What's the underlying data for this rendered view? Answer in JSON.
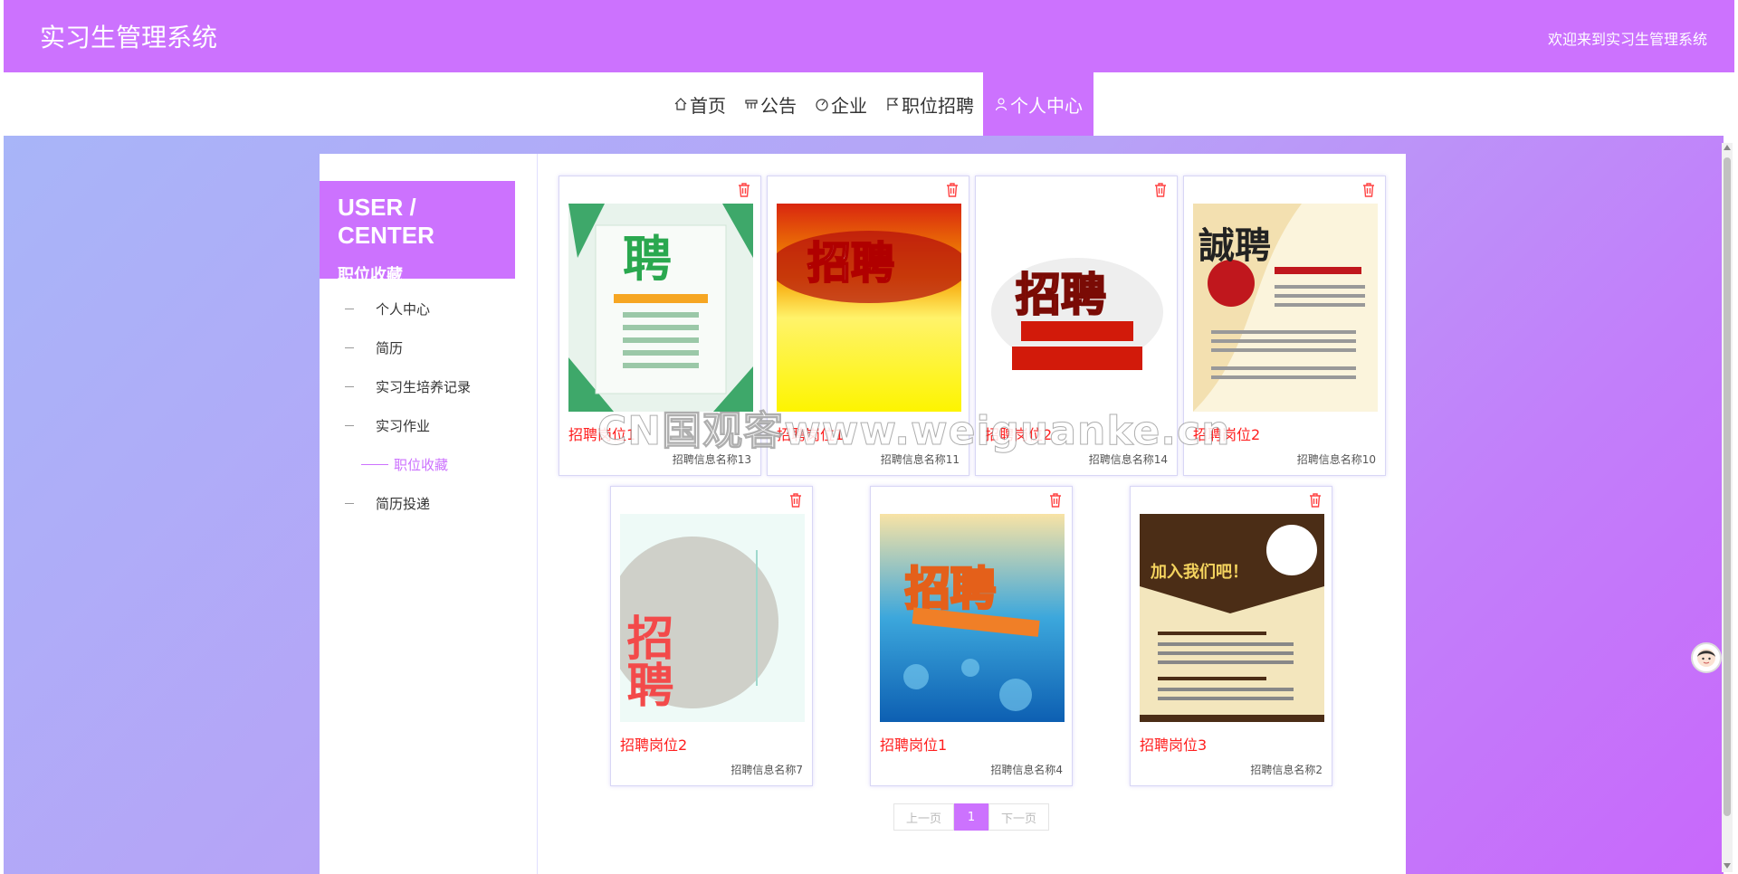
{
  "header": {
    "title": "实习生管理系统",
    "welcome": "欢迎来到实习生管理系统"
  },
  "nav": {
    "items": [
      {
        "label": "首页",
        "icon": "home-icon"
      },
      {
        "label": "公告",
        "icon": "notice-icon"
      },
      {
        "label": "企业",
        "icon": "dashboard-icon"
      },
      {
        "label": "职位招聘",
        "icon": "flag-icon"
      },
      {
        "label": "个人中心",
        "icon": "user-icon",
        "active": true
      }
    ]
  },
  "sidebar": {
    "head_en": "USER / CENTER",
    "head_cn": "职位收藏",
    "items": [
      {
        "label": "个人中心"
      },
      {
        "label": "简历"
      },
      {
        "label": "实习生培养记录"
      },
      {
        "label": "实习作业"
      },
      {
        "label": "职位收藏",
        "active": true
      },
      {
        "label": "简历投递"
      }
    ]
  },
  "cards": [
    {
      "title": "招聘岗位1",
      "subtitle": "招聘信息名称13",
      "poster_text": "聘"
    },
    {
      "title": "招聘岗位1",
      "subtitle": "招聘信息名称11",
      "poster_text": "招聘"
    },
    {
      "title": "招聘岗位2",
      "subtitle": "招聘信息名称14",
      "poster_text": "招聘"
    },
    {
      "title": "招聘岗位2",
      "subtitle": "招聘信息名称10",
      "poster_text": "誠聘"
    },
    {
      "title": "招聘岗位2",
      "subtitle": "招聘信息名称7",
      "poster_text": "招聘"
    },
    {
      "title": "招聘岗位1",
      "subtitle": "招聘信息名称4",
      "poster_text": "招聘"
    },
    {
      "title": "招聘岗位3",
      "subtitle": "招聘信息名称2",
      "poster_text": "加入我们吧！"
    }
  ],
  "pagination": {
    "prev": "上一页",
    "current": "1",
    "next": "下一页"
  },
  "watermark": "CN国观客www.weiguanke.cn",
  "colors": {
    "accent": "#cc72fe",
    "title_red": "#ff1f1f"
  }
}
